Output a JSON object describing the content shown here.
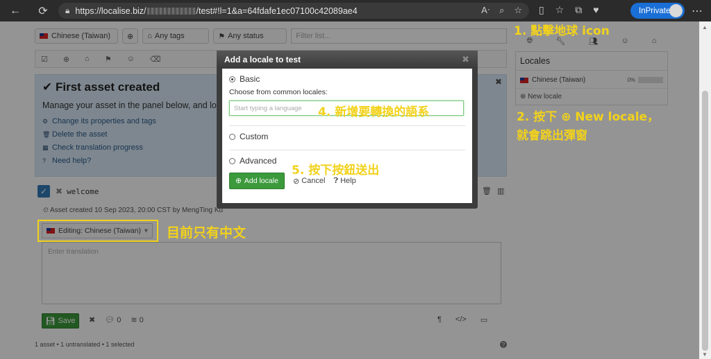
{
  "browser": {
    "url_prefix": "https://localise.biz/",
    "url_suffix": "/test#!l=1&a=64fdafe1ec07100c42089ae4",
    "inprivate_label": "InPrivate"
  },
  "filters": {
    "locale": "Chinese (Taiwan)",
    "tags": "Any tags",
    "status": "Any status",
    "search_placeholder": "Filter list..."
  },
  "first_asset": {
    "title": "First asset created",
    "message": "Manage your asset in the panel below, and look out",
    "links": [
      "Change its properties and tags",
      "Delete the asset",
      "Check translation progress",
      "Need help?"
    ]
  },
  "asset": {
    "key": "welcome",
    "created": "Asset created 10 Sep 2023, 20:00 CST by MengTing Ku",
    "editing": "Editing: Chinese (Taiwan)",
    "translation_placeholder": "Enter translation",
    "save_label": "Save",
    "comments": "0",
    "versions": "0"
  },
  "footer": "1 asset • 1 untranslated • 1 selected",
  "sidebar": {
    "title": "Locales",
    "locale": "Chinese (Taiwan)",
    "locale_pct": "0%",
    "new_locale": "New locale"
  },
  "modal": {
    "title": "Add a locale to test",
    "basic": "Basic",
    "choose": "Choose from common locales:",
    "input_placeholder": "Start typing a language",
    "custom": "Custom",
    "advanced": "Advanced",
    "add_label": "Add locale",
    "cancel_label": "Cancel",
    "help_label": "Help"
  },
  "annotations": {
    "note1": "1. 點擊地球 icon",
    "note2_line1": "2. 按下 ⊕ New locale，",
    "note2_line2": "就會跳出彈窗",
    "note4": "4. 新增要轉換的語系",
    "note5": "5. 按下按鈕送出",
    "note_current": "目前只有中文",
    "color": "#f2d21b"
  }
}
